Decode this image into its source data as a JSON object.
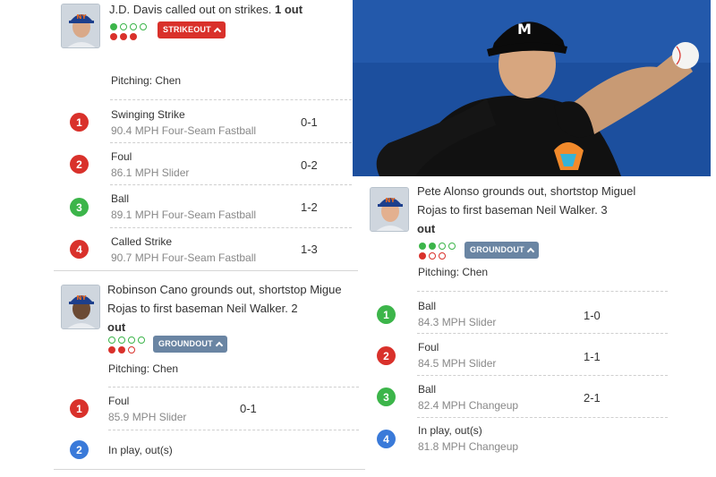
{
  "play1": {
    "headline": "J.D. Davis called out on strikes.",
    "outs": "1 out",
    "badge": "STRIKEOUT",
    "pitching": "Pitching: Chen",
    "pitches": [
      {
        "num": "1",
        "type": "Swinging Strike",
        "desc": "90.4 MPH Four-Seam Fastball",
        "count": "0-1",
        "color": "#d9312b"
      },
      {
        "num": "2",
        "type": "Foul",
        "desc": "86.1 MPH Slider",
        "count": "0-2",
        "color": "#d9312b"
      },
      {
        "num": "3",
        "type": "Ball",
        "desc": "89.1 MPH Four-Seam Fastball",
        "count": "1-2",
        "color": "#3cb54a"
      },
      {
        "num": "4",
        "type": "Called Strike",
        "desc": "90.7 MPH Four-Seam Fastball",
        "count": "1-3",
        "color": "#d9312b"
      }
    ]
  },
  "play2": {
    "headline_line1": "Robinson Cano grounds out, shortstop Migue",
    "headline_line2": "Rojas to first baseman Neil Walker. 2",
    "headline_line3": "out",
    "badge": "GROUNDOUT",
    "pitching": "Pitching: Chen",
    "pitches": [
      {
        "num": "1",
        "type": "Foul",
        "desc": "85.9 MPH Slider",
        "count": "0-1",
        "color": "#d9312b"
      },
      {
        "num": "2",
        "type": "In play, out(s)",
        "desc": "",
        "count": "",
        "color": "#3a7ad9"
      }
    ]
  },
  "play3": {
    "headline_line1": "Pete Alonso grounds out, shortstop Miguel",
    "headline_line2": "Rojas to first baseman Neil Walker. 3",
    "headline_line3": "out",
    "badge": "GROUNDOUT",
    "pitching": "Pitching: Chen",
    "pitches": [
      {
        "num": "1",
        "type": "Ball",
        "desc": "84.3 MPH Slider",
        "count": "1-0",
        "color": "#3cb54a"
      },
      {
        "num": "2",
        "type": "Foul",
        "desc": "84.5 MPH Slider",
        "count": "1-1",
        "color": "#d9312b"
      },
      {
        "num": "3",
        "type": "Ball",
        "desc": "82.4 MPH Changeup",
        "count": "2-1",
        "color": "#3cb54a"
      },
      {
        "num": "4",
        "type": "In play, out(s)",
        "desc": "81.8 MPH Changeup",
        "count": "",
        "color": "#3a7ad9"
      }
    ]
  },
  "photo": {
    "jersey_letter": "M"
  }
}
